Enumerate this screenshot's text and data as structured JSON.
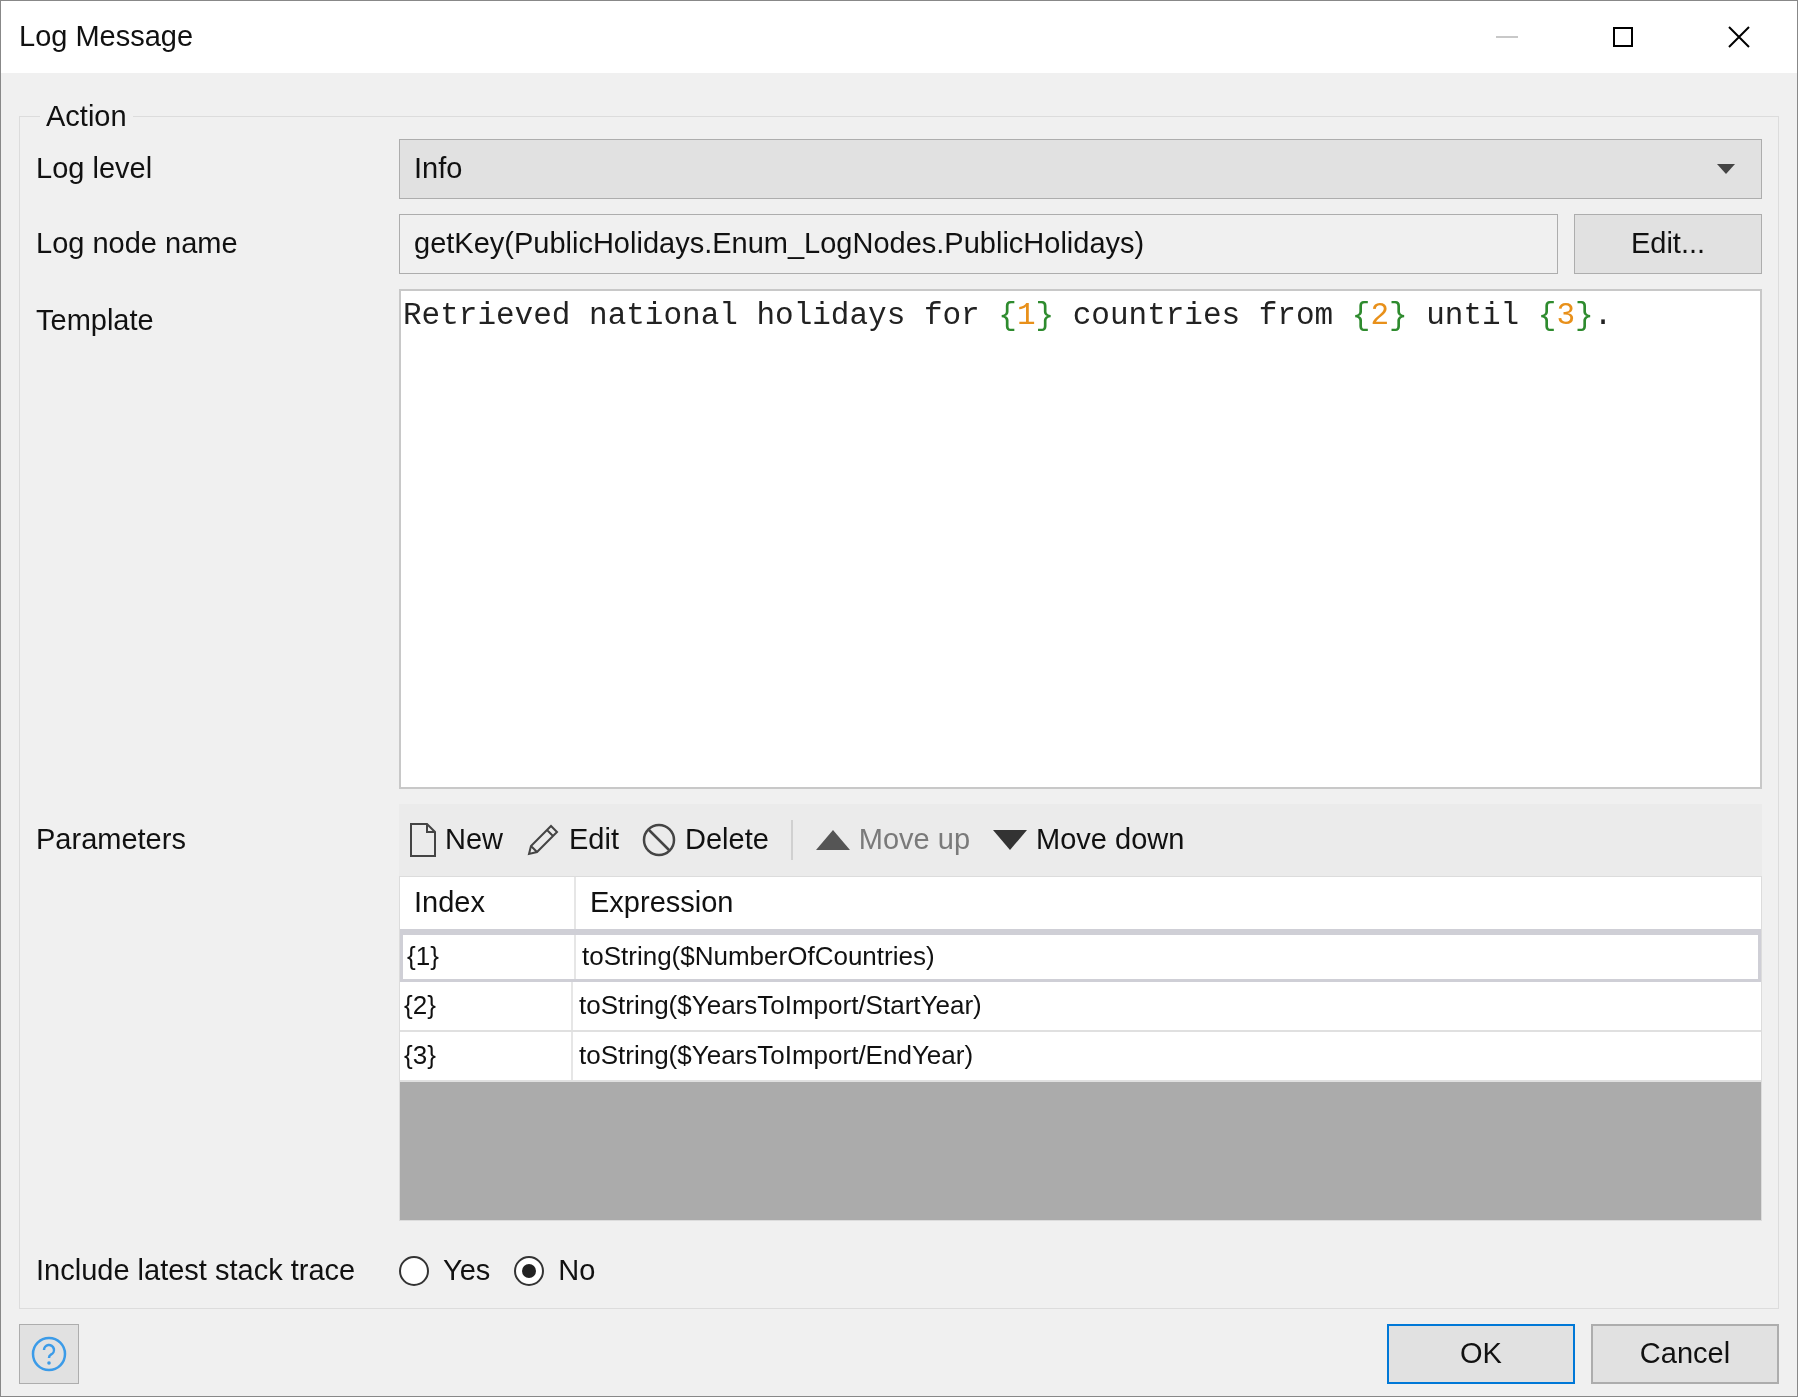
{
  "window": {
    "title": "Log Message",
    "minimize_disabled": true
  },
  "group": {
    "title": "Action"
  },
  "log_level": {
    "label": "Log level",
    "value": "Info"
  },
  "log_node_name": {
    "label": "Log node name",
    "value": "getKey(PublicHolidays.Enum_LogNodes.PublicHolidays)",
    "button": "Edit..."
  },
  "template": {
    "label": "Template",
    "segments": [
      {
        "kind": "text",
        "text": "Retrieved national holidays for "
      },
      {
        "kind": "brace",
        "text": "{"
      },
      {
        "kind": "number",
        "text": "1"
      },
      {
        "kind": "brace",
        "text": "}"
      },
      {
        "kind": "text",
        "text": " countries from "
      },
      {
        "kind": "brace",
        "text": "{"
      },
      {
        "kind": "number",
        "text": "2"
      },
      {
        "kind": "brace",
        "text": "}"
      },
      {
        "kind": "text",
        "text": " until "
      },
      {
        "kind": "brace",
        "text": "{"
      },
      {
        "kind": "number",
        "text": "3"
      },
      {
        "kind": "brace",
        "text": "}"
      },
      {
        "kind": "text",
        "text": "."
      }
    ]
  },
  "parameters": {
    "label": "Parameters",
    "toolbar": [
      {
        "kind": "new",
        "label": "New",
        "disabled": false
      },
      {
        "kind": "edit",
        "label": "Edit",
        "disabled": false
      },
      {
        "kind": "delete",
        "label": "Delete",
        "disabled": false
      },
      {
        "kind": "up",
        "label": "Move up",
        "disabled": true
      },
      {
        "kind": "down",
        "label": "Move down",
        "disabled": false
      }
    ],
    "columns": [
      "Index",
      "Expression"
    ],
    "rows": [
      {
        "index": "{1}",
        "expression": "toString($NumberOfCountries)",
        "selected": true
      },
      {
        "index": "{2}",
        "expression": "toString($YearsToImport/StartYear)",
        "selected": false
      },
      {
        "index": "{3}",
        "expression": "toString($YearsToImport/EndYear)",
        "selected": false
      }
    ]
  },
  "stack_trace": {
    "label": "Include latest stack trace",
    "options": [
      {
        "label": "Yes",
        "selected": false
      },
      {
        "label": "No",
        "selected": true
      }
    ]
  },
  "buttons": [
    {
      "label": "OK",
      "default": true
    },
    {
      "label": "Cancel",
      "default": false
    }
  ]
}
